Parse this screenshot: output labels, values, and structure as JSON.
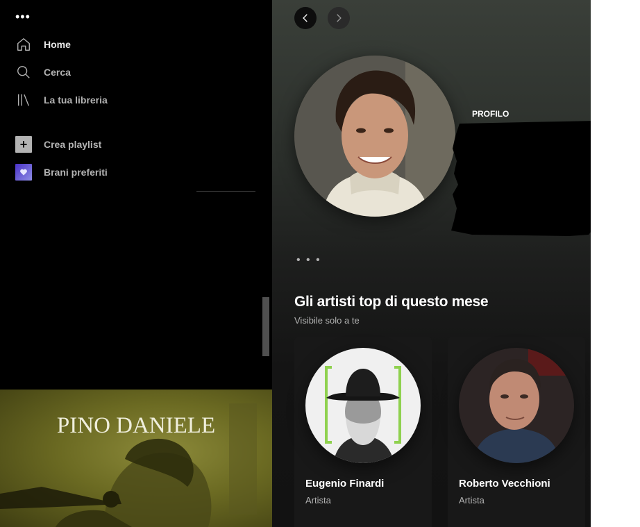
{
  "sidebar": {
    "more_label": "•••",
    "nav": [
      {
        "label": "Home",
        "icon": "home-icon"
      },
      {
        "label": "Cerca",
        "icon": "search-icon"
      },
      {
        "label": "La tua libreria",
        "icon": "library-icon"
      }
    ],
    "actions": [
      {
        "label": "Crea playlist",
        "icon": "plus-icon"
      },
      {
        "label": "Brani preferiti",
        "icon": "heart-icon"
      }
    ],
    "cover": {
      "title": "PINO DANIELE"
    }
  },
  "main": {
    "profile_label": "PROFILO",
    "more_label": "• • •",
    "section": {
      "title": "Gli artisti top di questo mese",
      "subtitle": "Visibile solo a te"
    },
    "artists": [
      {
        "name": "Eugenio Finardi",
        "type": "Artista"
      },
      {
        "name": "Roberto Vecchioni",
        "type": "Artista"
      }
    ]
  },
  "colors": {
    "background": "#121212",
    "sidebar": "#000000",
    "header_gradient_top": "#3a3f39",
    "card": "#181818",
    "text_secondary": "#b3b3b3",
    "finardi_frame": "#8fd14f"
  }
}
